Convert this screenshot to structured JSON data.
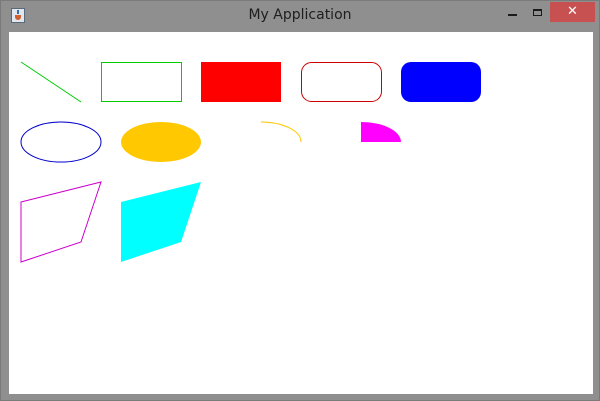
{
  "window": {
    "title": "My Application",
    "app_icon": "java-icon",
    "controls": {
      "minimize": "minimize-icon",
      "maximize": "maximize-icon",
      "close": "close-icon",
      "close_glyph": "✕"
    }
  },
  "canvas": {
    "shapes": [
      {
        "kind": "line",
        "stroke": "#00cc00"
      },
      {
        "kind": "rectangle",
        "stroke": "#00cc00",
        "fill": "none"
      },
      {
        "kind": "rectangle",
        "fill": "#ff0000"
      },
      {
        "kind": "rounded-rectangle",
        "stroke": "#cc0000",
        "fill": "none"
      },
      {
        "kind": "rounded-rectangle",
        "fill": "#0000ff"
      },
      {
        "kind": "ellipse",
        "stroke": "#0000cc",
        "fill": "none"
      },
      {
        "kind": "ellipse",
        "fill": "#ffc800"
      },
      {
        "kind": "arc",
        "stroke": "#ffc800"
      },
      {
        "kind": "pie",
        "fill": "#ff00ff"
      },
      {
        "kind": "polygon",
        "stroke": "#cc00cc",
        "fill": "none"
      },
      {
        "kind": "polygon",
        "fill": "#00ffff"
      }
    ]
  }
}
